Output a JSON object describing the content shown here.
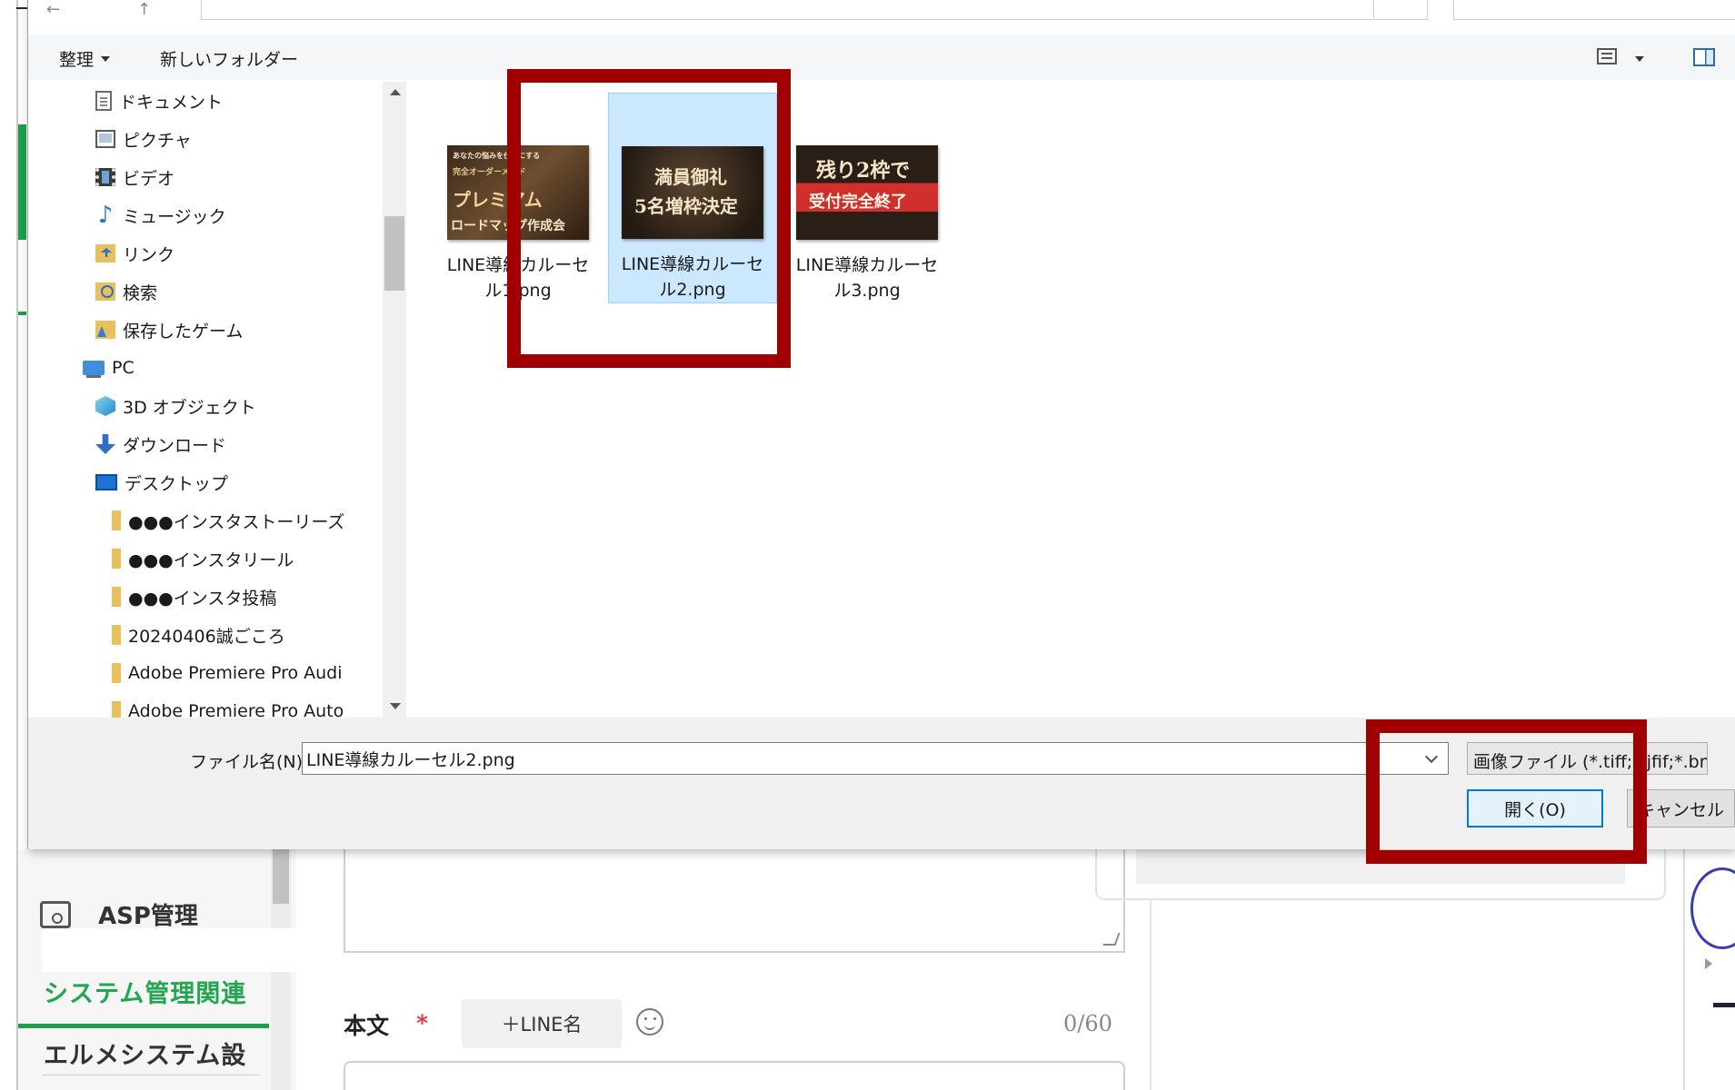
{
  "background_app": {
    "asp_label": "ASP管理",
    "system_mgmt_label": "システム管理関連",
    "lme_label": "エルメシステム設",
    "body_label": "本文",
    "required_mark": "*",
    "line_name_button": "＋LINE名",
    "char_counter": "0/60"
  },
  "dialog": {
    "toolbar": {
      "organize_label": "整理",
      "new_folder_label": "新しいフォルダー"
    },
    "nav_items": [
      {
        "label": "ドキュメント",
        "icon": "document-icon"
      },
      {
        "label": "ピクチャ",
        "icon": "pictures-icon"
      },
      {
        "label": "ビデオ",
        "icon": "video-icon"
      },
      {
        "label": "ミュージック",
        "icon": "music-icon"
      },
      {
        "label": "リンク",
        "icon": "links-folder-icon"
      },
      {
        "label": "検索",
        "icon": "search-folder-icon"
      },
      {
        "label": "保存したゲーム",
        "icon": "saved-games-icon"
      },
      {
        "label": "PC",
        "icon": "pc-icon"
      },
      {
        "label": "3D オブジェクト",
        "icon": "3d-objects-icon"
      },
      {
        "label": "ダウンロード",
        "icon": "download-icon"
      },
      {
        "label": "デスクトップ",
        "icon": "desktop-icon"
      },
      {
        "label": "●●●インスタストーリーズ",
        "icon": "folder-icon"
      },
      {
        "label": "●●●インスタリール",
        "icon": "folder-icon"
      },
      {
        "label": "●●●インスタ投稿",
        "icon": "folder-icon"
      },
      {
        "label": "20240406誠ごころ",
        "icon": "folder-icon"
      },
      {
        "label": "Adobe Premiere Pro Audi",
        "icon": "folder-icon"
      },
      {
        "label": "Adobe Premiere Pro Auto",
        "icon": "folder-icon"
      }
    ],
    "files": [
      {
        "name": "LINE導線カルーセル1.png",
        "selected": false,
        "thumb_text": [
          "あなたの悩みを仕事にする",
          "完全オーダーメイド",
          "プレミアム",
          "ロードマップ作成会"
        ]
      },
      {
        "name": "LINE導線カルーセル2.png",
        "selected": true,
        "thumb_text": [
          "満員御礼",
          "5名増枠決定"
        ]
      },
      {
        "name": "LINE導線カルーセル3.png",
        "selected": false,
        "thumb_text": [
          "残り2枠で",
          "受付完全終了"
        ]
      }
    ],
    "filename_label": "ファイル名(N):",
    "filename_value": "LINE導線カルーセル2.png",
    "file_type_filter": "画像ファイル (*.tiff;*.jfif;*.bmp;*.gi",
    "open_button": "開く(O)",
    "cancel_button": "キャンセル"
  },
  "colors": {
    "annotation_red": "#a10000",
    "selection_bg": "#cce8ff",
    "accent_blue": "#0078d7",
    "brand_green": "#1aa14a"
  }
}
